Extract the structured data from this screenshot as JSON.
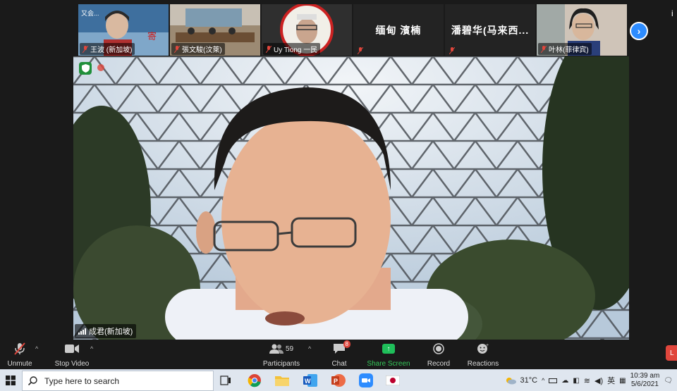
{
  "thumbnails": [
    {
      "name": "王波 (新加坡)",
      "overlay_text": "又会...",
      "kind": "video"
    },
    {
      "name": "張文駿(汶萊)",
      "kind": "video"
    },
    {
      "name": "Uy Tiong 一民",
      "kind": "video"
    },
    {
      "name": "缅甸 濱楠",
      "kind": "name"
    },
    {
      "name": "潘碧华(马来西...",
      "kind": "name"
    },
    {
      "name": "叶林(菲律宾)",
      "kind": "video"
    }
  ],
  "main_speaker": {
    "name": "成君(新加坡)"
  },
  "toolbar": {
    "unmute": "Unmute",
    "stop_video": "Stop Video",
    "participants": "Participants",
    "participants_count": "59",
    "chat": "Chat",
    "chat_badge": "8",
    "share_screen": "Share Screen",
    "record": "Record",
    "reactions": "Reactions",
    "leave": "L"
  },
  "taskbar": {
    "search_placeholder": "Type here to search",
    "temperature": "31°C",
    "ime": "英",
    "time": "10:39 am",
    "date": "5/6/2021"
  },
  "colors": {
    "accent": "#2d8cff",
    "share_green": "#35c759",
    "danger": "#e0463c"
  }
}
